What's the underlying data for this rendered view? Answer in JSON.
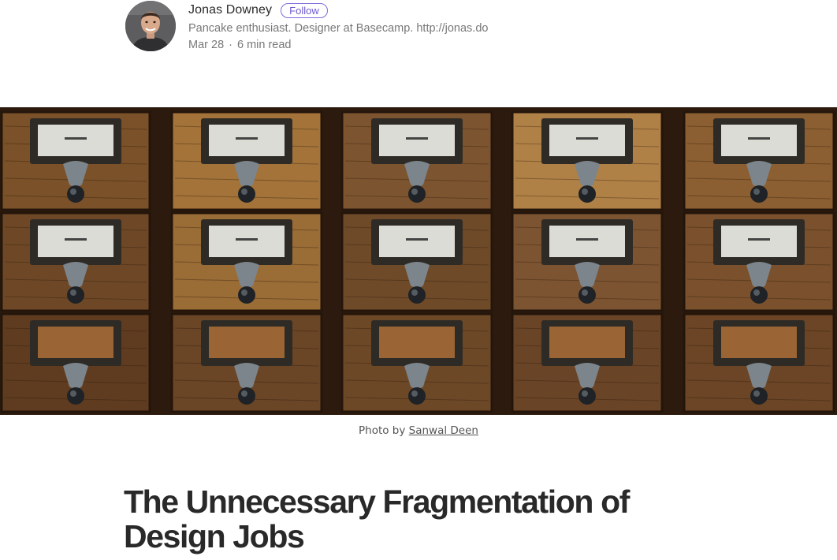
{
  "author": {
    "name": "Jonas Downey",
    "follow_label": "Follow",
    "bio": "Pancake enthusiast. Designer at Basecamp. http://jonas.do",
    "date": "Mar 28",
    "separator": "·",
    "read_time": "6 min read"
  },
  "hero": {
    "caption_prefix": "Photo by",
    "caption_credit": "Sanwal Deen"
  },
  "article": {
    "title": "The Unnecessary Fragmentation of Design Jobs"
  },
  "colors": {
    "follow_accent": "#7b6cd9",
    "wood_dark": "#3a2414",
    "wood_light": "#a87a3f"
  }
}
